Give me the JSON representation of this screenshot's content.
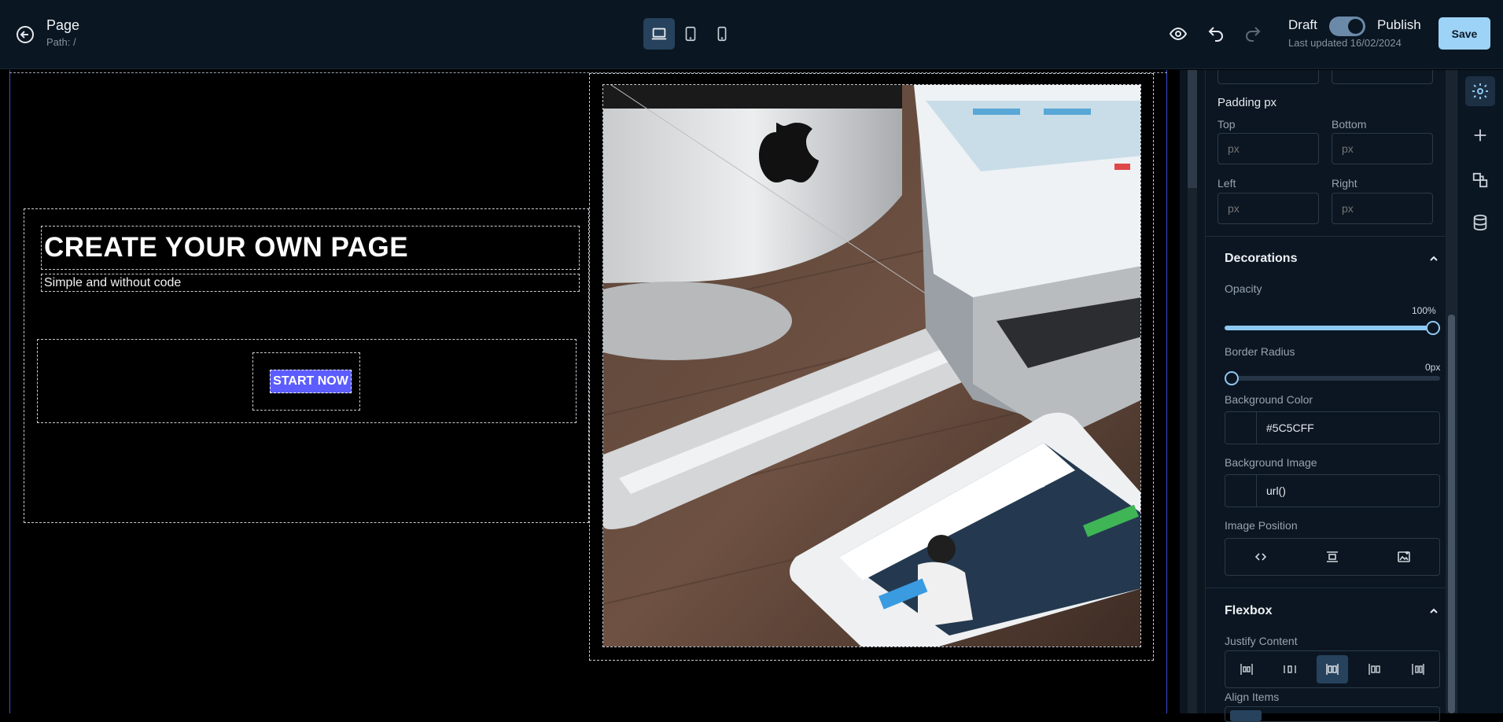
{
  "header": {
    "title": "Page",
    "path": "Path: /",
    "draft_label": "Draft",
    "publish_label": "Publish",
    "last_updated": "Last updated 16/02/2024",
    "save_label": "Save",
    "published": true,
    "active_device": "desktop"
  },
  "canvas": {
    "heading": "CREATE YOUR OWN PAGE",
    "subheading": "Simple and  without code",
    "button_label": "START NOW",
    "button_color": "#5C5CFF",
    "image_icon": "laptop-desk-photo"
  },
  "inspector": {
    "padding_label": "Padding px",
    "top_label": "Top",
    "bottom_label": "Bottom",
    "left_label": "Left",
    "right_label": "Right",
    "px_placeholder": "px",
    "decorations_title": "Decorations",
    "opacity_label": "Opacity",
    "opacity_value": "100%",
    "opacity_fraction": 1.0,
    "border_radius_label": "Border Radius",
    "border_radius_value": "0px",
    "border_radius_fraction": 0.0,
    "background_color_label": "Background Color",
    "background_color_value": "#5C5CFF",
    "background_image_label": "Background Image",
    "background_image_value": "url()",
    "image_position_label": "Image Position",
    "flexbox_title": "Flexbox",
    "justify_label": "Justify Content",
    "justify_active_index": 2,
    "align_label": "Align Items"
  }
}
